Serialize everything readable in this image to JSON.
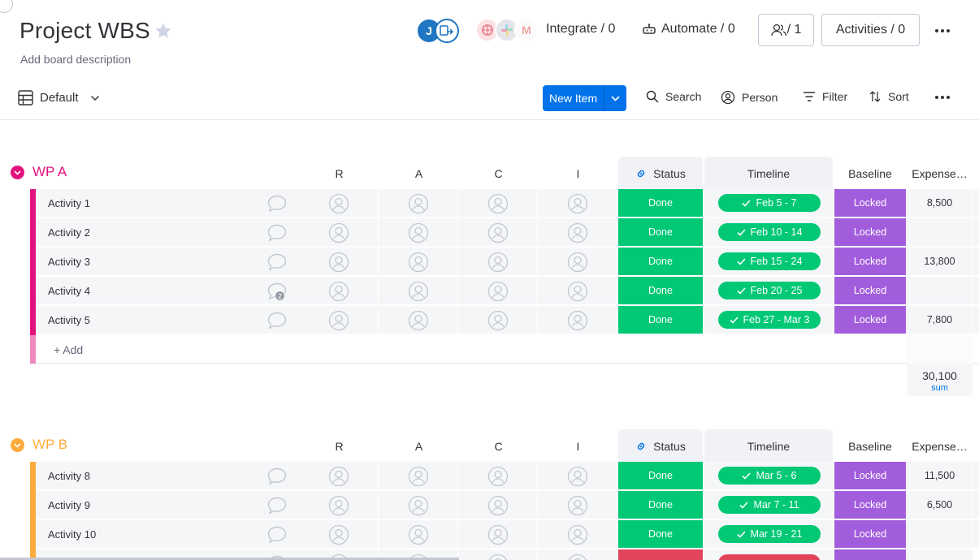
{
  "header": {
    "title": "Project WBS",
    "description": "Add board description",
    "avatar_initial": "J",
    "integrate_label": "Integrate / 0",
    "automate_label": "Automate / 0",
    "members_label": "/ 1",
    "activities_label": "Activities / 0",
    "integration_logos": [
      "gear-logo",
      "slack-logo",
      "gmail-logo"
    ],
    "gmail_letter": "M"
  },
  "toolbar": {
    "view_label": "Default",
    "new_item_label": "New Item",
    "search_label": "Search",
    "person_label": "Person",
    "filter_label": "Filter",
    "sort_label": "Sort"
  },
  "columns": {
    "r": "R",
    "a": "A",
    "c": "C",
    "i": "I",
    "status": "Status",
    "timeline": "Timeline",
    "baseline": "Baseline",
    "expenses": "Expense…"
  },
  "colors": {
    "accent": "#0073ea",
    "wp_a": "#e2137e",
    "wp_b": "#fdab3d",
    "done": "#00c875",
    "stuck": "#e2445c",
    "locked": "#a25ddc"
  },
  "groups": [
    {
      "title": "WP A",
      "add_label": "+ Add",
      "sum_value": "30,100",
      "sum_label": "sum",
      "rows": [
        {
          "name": "Activity 1",
          "status": "Done",
          "timeline": "Feb 5 - 7",
          "baseline": "Locked",
          "expense": "8,500",
          "updates": ""
        },
        {
          "name": "Activity 2",
          "status": "Done",
          "timeline": "Feb 10 - 14",
          "baseline": "Locked",
          "expense": "",
          "updates": ""
        },
        {
          "name": "Activity 3",
          "status": "Done",
          "timeline": "Feb 15 - 24",
          "baseline": "Locked",
          "expense": "13,800",
          "updates": ""
        },
        {
          "name": "Activity 4",
          "status": "Done",
          "timeline": "Feb 20 - 25",
          "baseline": "Locked",
          "expense": "",
          "updates": "2"
        },
        {
          "name": "Activity 5",
          "status": "Done",
          "timeline": "Feb 27 - Mar 3",
          "baseline": "Locked",
          "expense": "7,800",
          "updates": ""
        }
      ]
    },
    {
      "title": "WP B",
      "rows": [
        {
          "name": "Activity 8",
          "status": "Done",
          "timeline": "Mar 5 - 6",
          "baseline": "Locked",
          "expense": "11,500",
          "updates": ""
        },
        {
          "name": "Activity 9",
          "status": "Done",
          "timeline": "Mar 7 - 11",
          "baseline": "Locked",
          "expense": "6,500",
          "updates": ""
        },
        {
          "name": "Activity 10",
          "status": "Done",
          "timeline": "Mar 19 - 21",
          "baseline": "Locked",
          "expense": "",
          "updates": ""
        }
      ]
    }
  ]
}
